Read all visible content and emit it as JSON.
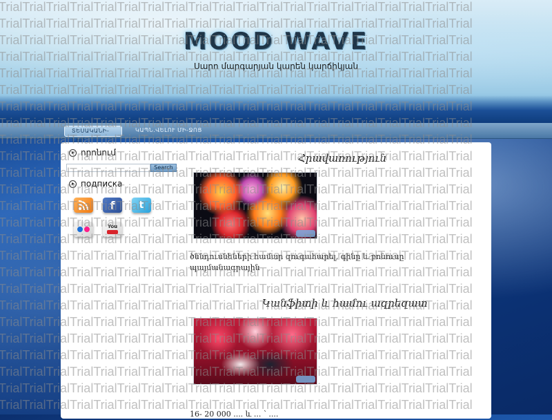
{
  "header": {
    "title": "MOOD WAVE",
    "subtitle": "Սարո մարգարյան կարեն կարճիկյան"
  },
  "nav": {
    "items": [
      {
        "label": "ՏԵՍԱԿԱՆԻ-ՆԵՐ",
        "active": true
      },
      {
        "label": "ԿԱՊՆ.ՎԵԼՈՒ ՄԻ-ՋՈՑ",
        "active": false
      }
    ]
  },
  "sidebar": {
    "search": {
      "title": "որոնում",
      "placeholder": "",
      "button_label": "Search"
    },
    "subscribe": {
      "title": "подписка",
      "icons": [
        "rss-icon",
        "facebook-icon",
        "twitter-icon",
        "flickr-icon",
        "youtube-icon"
      ],
      "fb_glyph": "f",
      "tw_glyph": "t",
      "yt_glyph": "You"
    }
  },
  "posts": [
    {
      "title": "Հրավառություն",
      "image": "fireworks-image",
      "text": "ծննդուսնեների համար զուգահարել, գինը և բոնուսը պայմանագրային"
    },
    {
      "title": "Կանֆիտի և համու ազրեզատ",
      "image": "party-image",
      "text": "16- 20 000 .... և ... ՝ ...."
    }
  ],
  "watermark": {
    "word": "Trial"
  },
  "colors": {
    "nav_bar": "#4a78a6",
    "panel": "#ffffff",
    "search_button": "#6f9dc8",
    "title_glow": "#7ec0e8"
  }
}
